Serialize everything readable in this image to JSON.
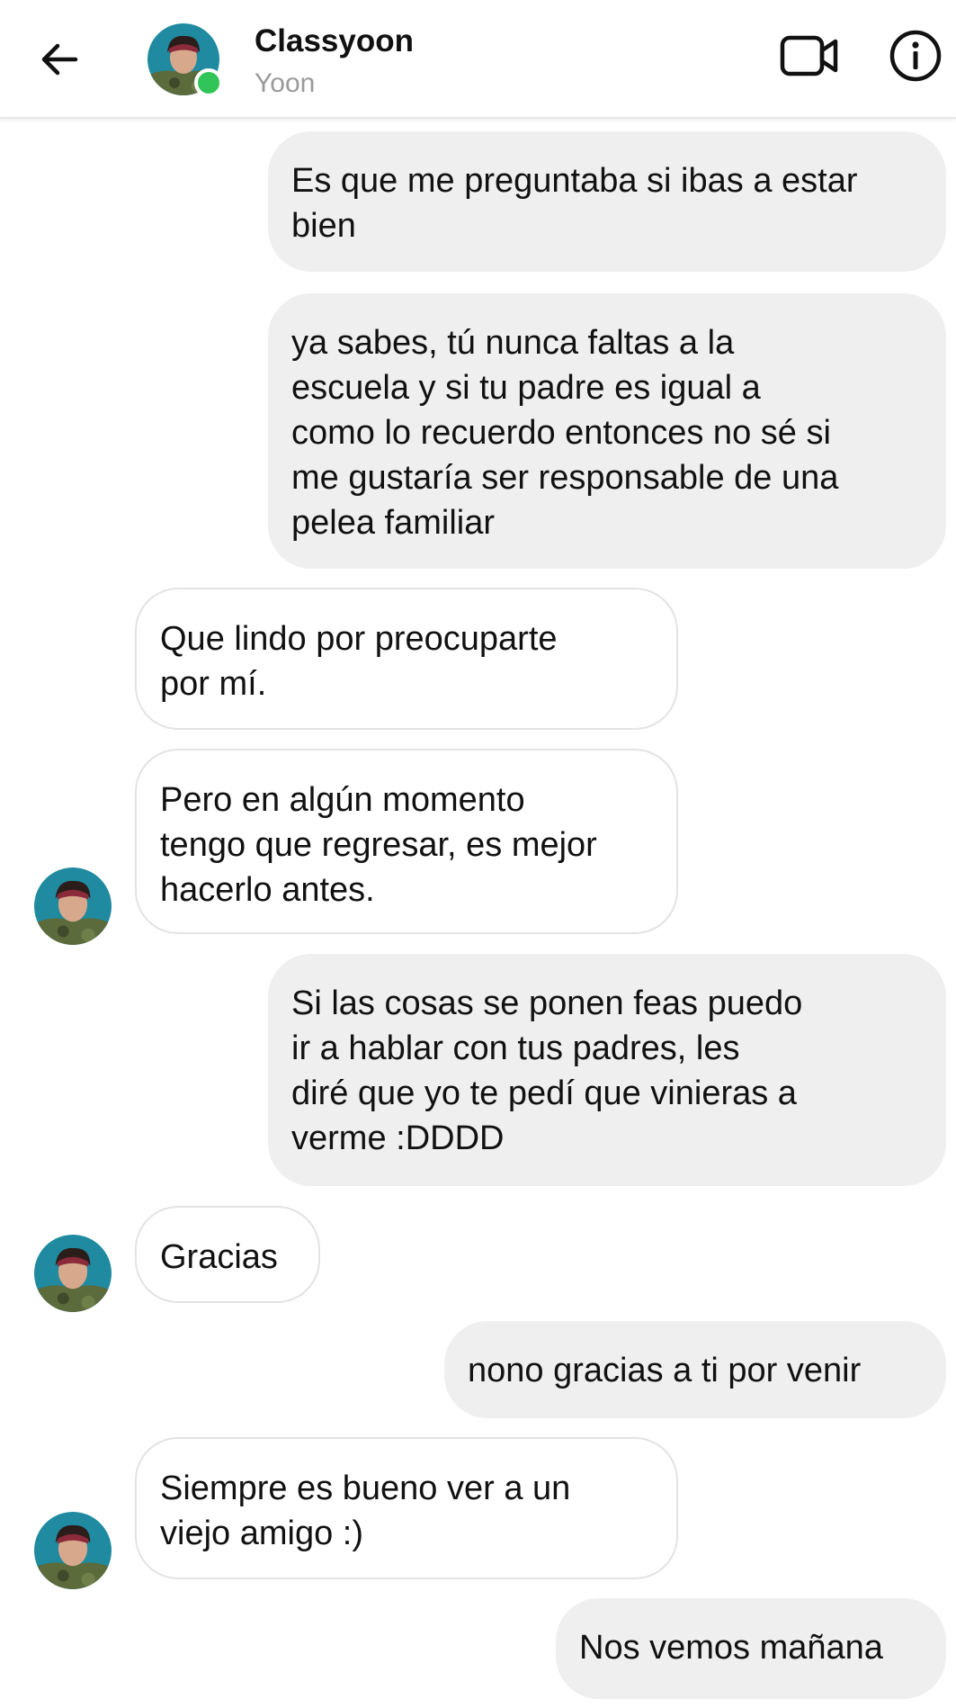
{
  "header": {
    "contact_name": "Classyoon",
    "contact_subtitle": "Yoon",
    "online": true,
    "online_color": "#31c458",
    "icons": [
      "arrow-back-icon",
      "video-call-icon",
      "info-icon"
    ]
  },
  "messages": [
    {
      "side": "out",
      "text": "Es que me preguntaba si ibas a estar\nbien"
    },
    {
      "side": "out",
      "text": "ya sabes, tú nunca faltas a la\nescuela y si tu padre es igual a\ncomo lo recuerdo entonces no sé si\nme gustaría ser responsable de una\npelea familiar"
    },
    {
      "side": "in",
      "text": "Que lindo por preocuparte\npor mí."
    },
    {
      "side": "in",
      "text": "Pero en algún momento\ntengo que regresar, es mejor\nhacerlo antes."
    },
    {
      "side": "out",
      "text": "Si las cosas se ponen feas puedo\nir a hablar con tus padres, les\ndiré que yo te pedí que vinieras a\nverme :DDDD"
    },
    {
      "side": "in",
      "text": "Gracias"
    },
    {
      "side": "out",
      "text": "nono gracias a ti por venir"
    },
    {
      "side": "in",
      "text": "Siempre es bueno ver a un\nviejo amigo :)"
    },
    {
      "side": "out",
      "text": "Nos vemos mañana"
    }
  ],
  "colors": {
    "outgoing_bubble": "#efefef",
    "incoming_bubble_border": "#e3e3e3",
    "subtitle": "#9a9a9a"
  }
}
